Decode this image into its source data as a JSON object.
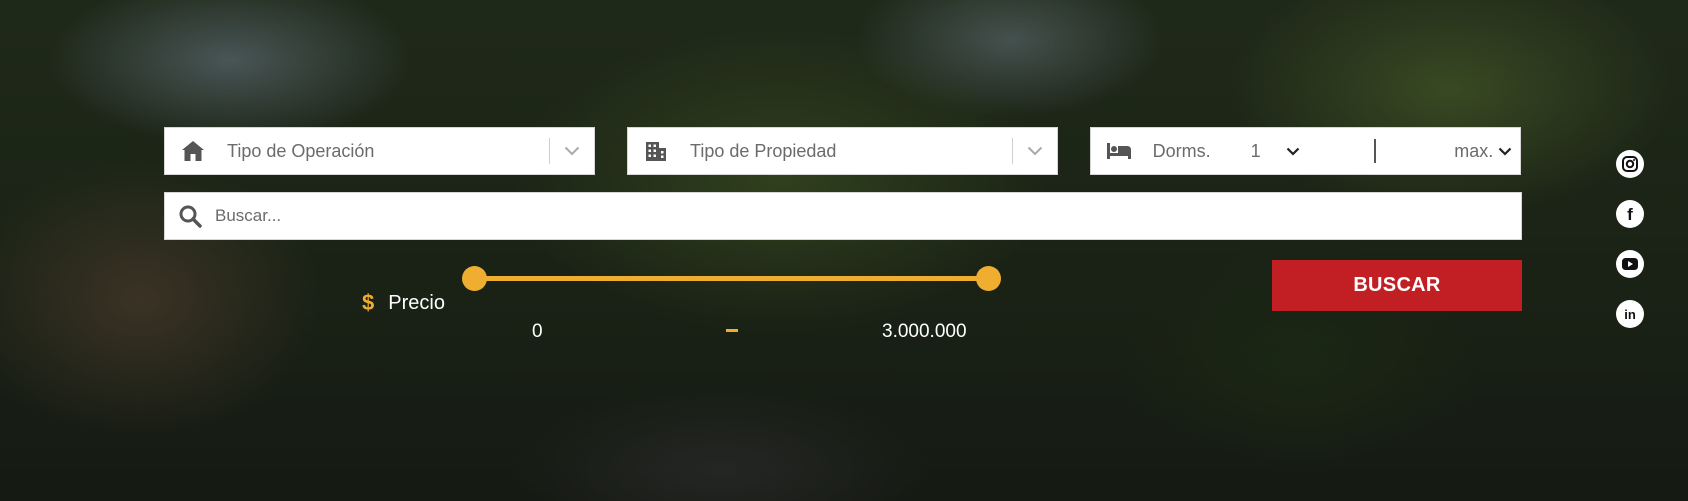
{
  "filters": {
    "operation": {
      "label": "Tipo de Operación",
      "icon": "home-icon"
    },
    "property": {
      "label": "Tipo de Propiedad",
      "icon": "building-icon"
    },
    "bedrooms": {
      "label": "Dorms.",
      "min_value": "1",
      "max_value": "max.",
      "icon": "bed-icon"
    }
  },
  "search": {
    "placeholder": "Buscar...",
    "value": "",
    "icon": "search-icon"
  },
  "price": {
    "label": "Precio",
    "currency_symbol": "$",
    "min_display": "0",
    "max_display": "3.000.000",
    "slider_min_fraction": 0,
    "slider_max_fraction": 1
  },
  "action": {
    "search_button_label": "BUSCAR"
  },
  "social_links": [
    "instagram-icon",
    "facebook-icon",
    "youtube-icon",
    "linkedin-icon"
  ],
  "colors": {
    "accent": "#f0ae30",
    "primary_button": "#c21f24",
    "field_text": "#6b6b6b"
  }
}
